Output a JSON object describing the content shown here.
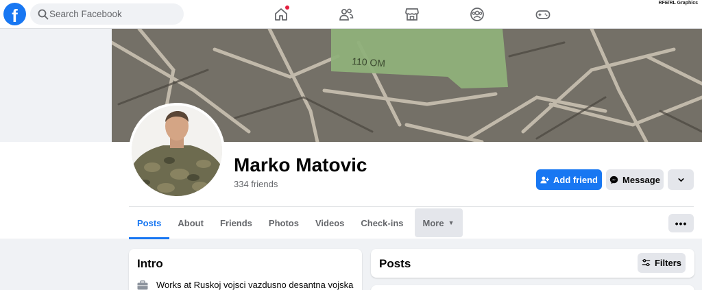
{
  "topbar": {
    "logo": "f",
    "search_placeholder": "Search Facebook",
    "nav_icons": [
      "home-icon",
      "friends-icon",
      "marketplace-icon",
      "groups-icon",
      "gaming-icon"
    ],
    "credit": "RFE/RL Graphics"
  },
  "profile": {
    "name": "Marko Matovic",
    "friends": "334 friends",
    "add_friend_label": "Add friend",
    "message_label": "Message"
  },
  "tabs": [
    "Posts",
    "About",
    "Friends",
    "Photos",
    "Videos",
    "Check-ins"
  ],
  "more_label": "More",
  "intro": {
    "title": "Intro",
    "work": "Works at Ruskoj vojsci vazdusno desantna vojska"
  },
  "posts": {
    "title": "Posts",
    "filters_label": "Filters"
  },
  "colors": {
    "brand": "#1877f2",
    "background": "#f0f2f5",
    "notification": "#e41e3f"
  }
}
